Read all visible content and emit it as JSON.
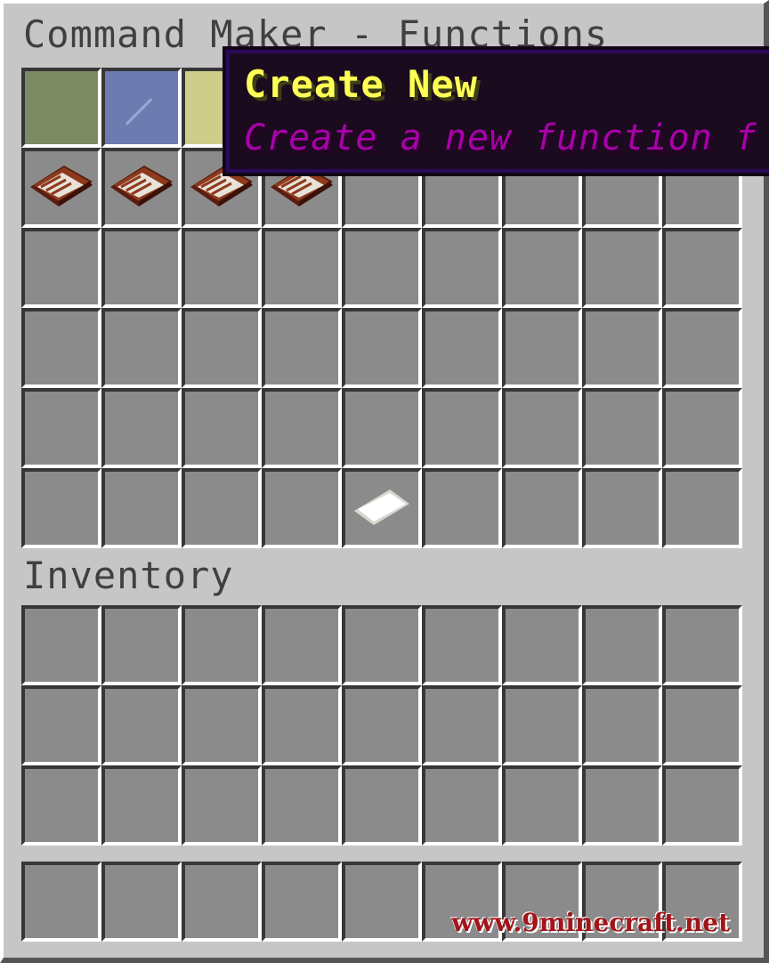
{
  "window": {
    "title": "Command Maker - Functions",
    "inventory_title": "Inventory"
  },
  "tooltip": {
    "title": "Create New",
    "subtitle": "Create a new function f"
  },
  "watermark": "www.9minecraft.net",
  "colors": {
    "tooltip_title": "#ffff55",
    "tooltip_subtitle": "#aa00aa",
    "pane_green": "#7d8a63",
    "pane_blue": "#6c7bb0",
    "pane_yellow": "#cfcd8a"
  },
  "top_grid": {
    "rows": 6,
    "cols": 9,
    "items": [
      {
        "slot": 0,
        "icon": "green-stained-glass-pane-icon"
      },
      {
        "slot": 1,
        "icon": "blue-stained-glass-pane-icon"
      },
      {
        "slot": 2,
        "icon": "yellow-stained-glass-pane-icon"
      },
      {
        "slot": 9,
        "icon": "book-icon"
      },
      {
        "slot": 10,
        "icon": "book-icon"
      },
      {
        "slot": 11,
        "icon": "book-icon"
      },
      {
        "slot": 12,
        "icon": "book-icon"
      },
      {
        "slot": 49,
        "icon": "paper-icon"
      }
    ]
  },
  "inventory_grid": {
    "rows": 3,
    "cols": 9
  },
  "hotbar_grid": {
    "rows": 1,
    "cols": 9
  }
}
